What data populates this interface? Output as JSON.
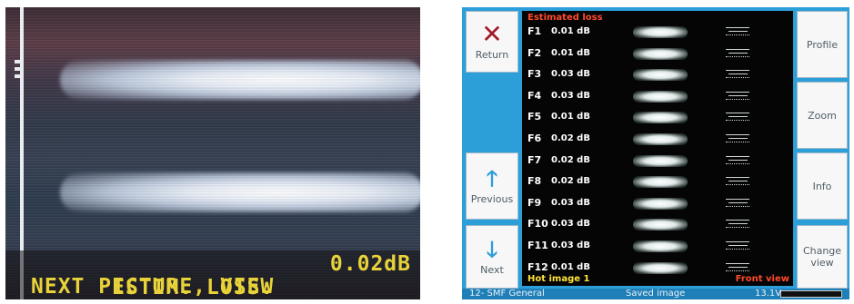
{
  "left_view": {
    "osd_line1_label": "ESTIM. LOSS:",
    "osd_line1_value": "0.02dB",
    "osd_line2": "NEXT PICTURE, VIEW",
    "osd_color": "#e8d23a"
  },
  "right_view": {
    "panel_title": "Estimated loss",
    "buttons": {
      "return": "Return",
      "previous": "Previous",
      "next": "Next",
      "profile": "Profile",
      "zoom": "Zoom",
      "info": "Info",
      "change_view": "Change view"
    },
    "fibers": [
      {
        "id": "F1",
        "loss": "0.01 dB"
      },
      {
        "id": "F2",
        "loss": "0.01 dB"
      },
      {
        "id": "F3",
        "loss": "0.03 dB"
      },
      {
        "id": "F4",
        "loss": "0.03 dB"
      },
      {
        "id": "F5",
        "loss": "0.01 dB"
      },
      {
        "id": "F6",
        "loss": "0.02 dB"
      },
      {
        "id": "F7",
        "loss": "0.02 dB"
      },
      {
        "id": "F8",
        "loss": "0.02 dB"
      },
      {
        "id": "F9",
        "loss": "0.03 dB"
      },
      {
        "id": "F10",
        "loss": "0.03 dB"
      },
      {
        "id": "F11",
        "loss": "0.03 dB"
      },
      {
        "id": "F12",
        "loss": "0.01 dB"
      }
    ],
    "hot_image": "Hot image 1",
    "front_view": "Front view",
    "status": {
      "preset": "12- SMF General",
      "saved": "Saved image",
      "voltage": "13.1V"
    },
    "colors": {
      "background": "#2c9ed8",
      "title_red": "#ff4a2a",
      "hot_yellow": "#ffe23a"
    },
    "icons": [
      "close-x-icon",
      "arrow-up-icon",
      "arrow-down-icon",
      "battery-icon"
    ]
  }
}
